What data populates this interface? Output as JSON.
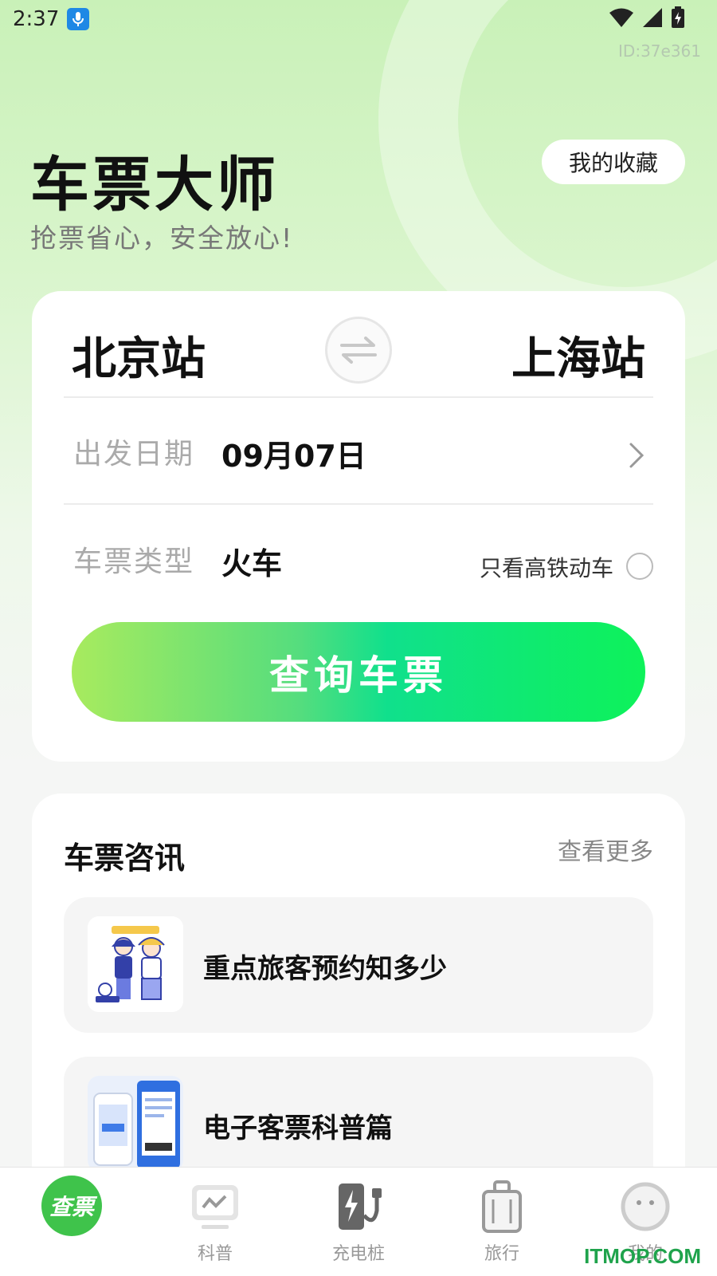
{
  "status_bar": {
    "time": "2:37"
  },
  "device_id": "ID:37e361",
  "header": {
    "title": "车票大师",
    "subtitle": "抢票省心，安全放心!",
    "favorites_label": "我的收藏"
  },
  "search": {
    "from_station": "北京站",
    "to_station": "上海站",
    "date_label": "出发日期",
    "date_value": "09月07日",
    "type_label": "车票类型",
    "type_value": "火车",
    "highspeed_label": "只看高铁动车",
    "highspeed_checked": false,
    "query_label": "查询车票"
  },
  "news": {
    "title": "车票咨讯",
    "more_label": "查看更多",
    "items": [
      {
        "title": "重点旅客预约知多少"
      },
      {
        "title": "电子客票科普篇"
      }
    ]
  },
  "tabs": [
    {
      "label": "查票",
      "icon": "ticket-search-icon",
      "active": true
    },
    {
      "label": "科普",
      "icon": "science-screen-icon",
      "active": false
    },
    {
      "label": "充电桩",
      "icon": "charging-station-icon",
      "active": false
    },
    {
      "label": "旅行",
      "icon": "luggage-icon",
      "active": false
    },
    {
      "label": "我的",
      "icon": "profile-icon",
      "active": false
    }
  ],
  "watermark": "ITMOP.COM",
  "colors": {
    "accent_green": "#3fc34b",
    "button_gradient_start": "#a8eb5e",
    "button_gradient_end": "#0ef25a"
  }
}
